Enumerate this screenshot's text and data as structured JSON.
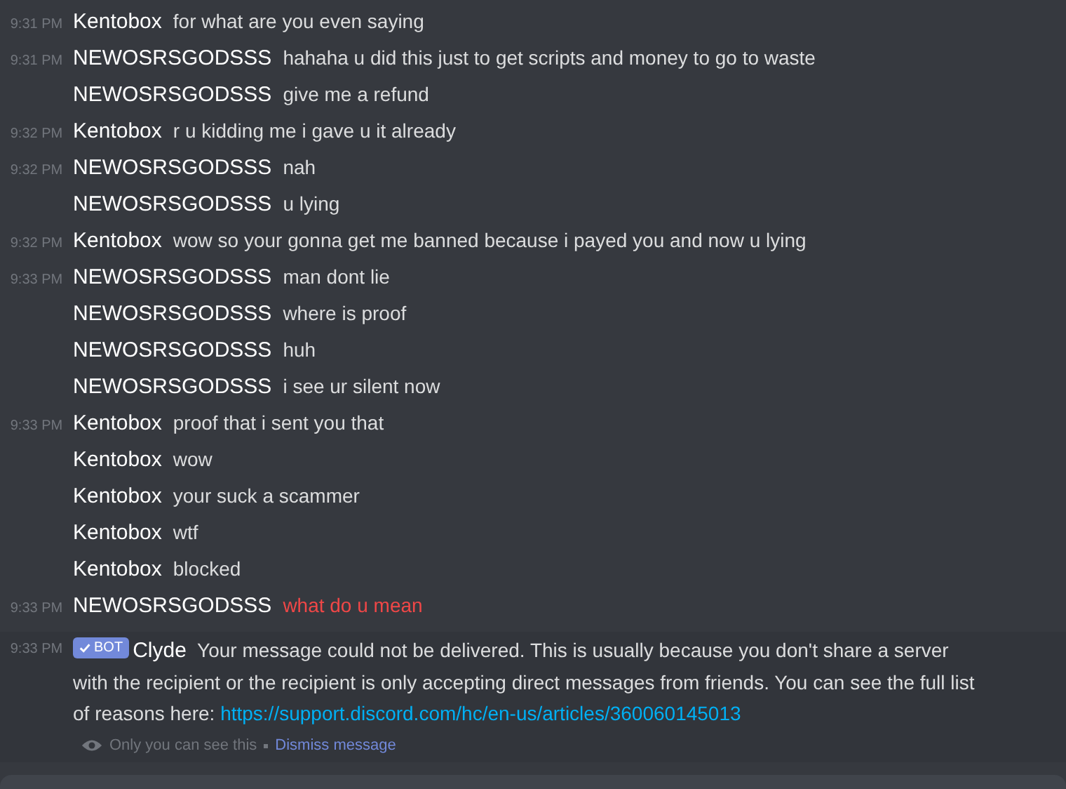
{
  "messages": [
    {
      "time": "9:31 PM",
      "author": "Kentobox",
      "text": "for what are you even saying",
      "failed": false
    },
    {
      "time": "9:31 PM",
      "author": "NEWOSRSGODSSS",
      "text": "hahaha u did this just to get scripts and money to go to waste",
      "failed": false
    },
    {
      "author": "NEWOSRSGODSSS",
      "text": "give me a refund",
      "failed": false
    },
    {
      "time": "9:32 PM",
      "author": "Kentobox",
      "text": "r u kidding me i gave u it already",
      "failed": false
    },
    {
      "time": "9:32 PM",
      "author": "NEWOSRSGODSSS",
      "text": "nah",
      "failed": false
    },
    {
      "author": "NEWOSRSGODSSS",
      "text": "u lying",
      "failed": false
    },
    {
      "time": "9:32 PM",
      "author": "Kentobox",
      "text": "wow so your gonna get me banned because i payed you and now u lying",
      "failed": false
    },
    {
      "time": "9:33 PM",
      "author": "NEWOSRSGODSSS",
      "text": "man dont lie",
      "failed": false
    },
    {
      "author": "NEWOSRSGODSSS",
      "text": "where is proof",
      "failed": false
    },
    {
      "author": "NEWOSRSGODSSS",
      "text": "huh",
      "failed": false
    },
    {
      "author": "NEWOSRSGODSSS",
      "text": "i see ur silent now",
      "failed": false
    },
    {
      "time": "9:33 PM",
      "author": "Kentobox",
      "text": "proof that i sent you that",
      "failed": false
    },
    {
      "author": "Kentobox",
      "text": "wow",
      "failed": false
    },
    {
      "author": "Kentobox",
      "text": "your suck a scammer",
      "failed": false
    },
    {
      "author": "Kentobox",
      "text": "wtf",
      "failed": false
    },
    {
      "author": "Kentobox",
      "text": "blocked",
      "failed": false
    },
    {
      "time": "9:33 PM",
      "author": "NEWOSRSGODSSS",
      "text": "what do u mean",
      "failed": true
    }
  ],
  "bot_message": {
    "time": "9:33 PM",
    "badge": "BOT",
    "author": "Clyde",
    "text": "Your message could not be delivered. This is usually because you don't share a server with the recipient or the recipient is only accepting direct messages from friends. You can see the full list of reasons here:",
    "link": "https://support.discord.com/hc/en-us/articles/360060145013",
    "notice": "Only you can see this",
    "dismiss": "Dismiss message"
  }
}
